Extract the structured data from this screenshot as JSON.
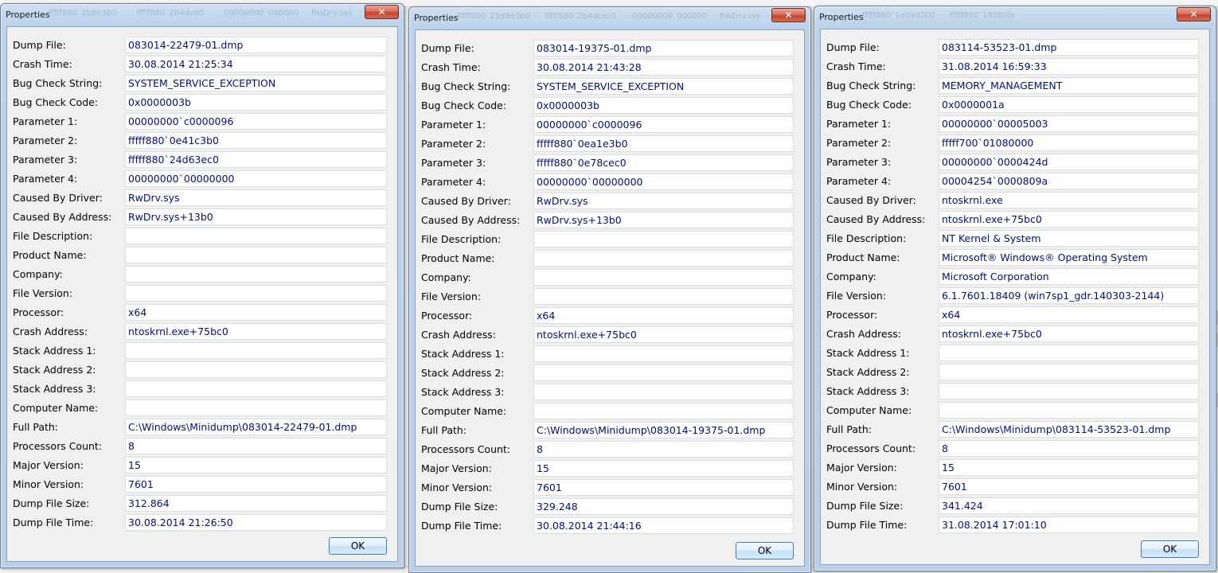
{
  "labels": [
    "Dump File:",
    "Crash Time:",
    "Bug Check String:",
    "Bug Check Code:",
    "Parameter 1:",
    "Parameter 2:",
    "Parameter 3:",
    "Parameter 4:",
    "Caused By Driver:",
    "Caused By Address:",
    "File Description:",
    "Product Name:",
    "Company:",
    "File Version:",
    "Processor:",
    "Crash Address:",
    "Stack Address 1:",
    "Stack Address 2:",
    "Stack Address 3:",
    "Computer Name:",
    "Full Path:",
    "Processors Count:",
    "Major Version:",
    "Minor Version:",
    "Dump File Size:",
    "Dump File Time:"
  ],
  "background": {
    "ghost_text": [
      [
        "fffff880`2b8e3b0",
        "fffff880`2b4dce0",
        "00000000`000000",
        "RwDrv.sys"
      ],
      [
        "fffff880`25d8e3b0",
        "fffff880`2b4dcec0",
        "00000000`000000",
        "RwDrv.sys"
      ],
      [
        "fffff880`1ebad3b0",
        "fffff880`1808fde"
      ]
    ]
  },
  "dialogs": [
    {
      "title": "Properties",
      "close_glyph": "✕",
      "ok_label": "OK",
      "values": [
        "083014-22479-01.dmp",
        "30.08.2014 21:25:34",
        "SYSTEM_SERVICE_EXCEPTION",
        "0x0000003b",
        "00000000`c0000096",
        "fffff880`0e41c3b0",
        "fffff880`24d63ec0",
        "00000000`00000000",
        "RwDrv.sys",
        "RwDrv.sys+13b0",
        "",
        "",
        "",
        "",
        "x64",
        "ntoskrnl.exe+75bc0",
        "",
        "",
        "",
        "",
        "C:\\Windows\\Minidump\\083014-22479-01.dmp",
        "8",
        "15",
        "7601",
        "312.864",
        "30.08.2014 21:26:50"
      ]
    },
    {
      "title": "Properties",
      "close_glyph": "✕",
      "ok_label": "OK",
      "values": [
        "083014-19375-01.dmp",
        "30.08.2014 21:43:28",
        "SYSTEM_SERVICE_EXCEPTION",
        "0x0000003b",
        "00000000`c0000096",
        "fffff880`0ea1e3b0",
        "fffff880`0e78cec0",
        "00000000`00000000",
        "RwDrv.sys",
        "RwDrv.sys+13b0",
        "",
        "",
        "",
        "",
        "x64",
        "ntoskrnl.exe+75bc0",
        "",
        "",
        "",
        "",
        "C:\\Windows\\Minidump\\083014-19375-01.dmp",
        "8",
        "15",
        "7601",
        "329.248",
        "30.08.2014 21:44:16"
      ]
    },
    {
      "title": "Properties",
      "close_glyph": "✕",
      "ok_label": "OK",
      "values": [
        "083114-53523-01.dmp",
        "31.08.2014 16:59:33",
        "MEMORY_MANAGEMENT",
        "0x0000001a",
        "00000000`00005003",
        "fffff700`01080000",
        "00000000`0000424d",
        "00004254`0000809a",
        "ntoskrnl.exe",
        "ntoskrnl.exe+75bc0",
        "NT Kernel & System",
        "Microsoft® Windows® Operating System",
        "Microsoft Corporation",
        "6.1.7601.18409 (win7sp1_gdr.140303-2144)",
        "x64",
        "ntoskrnl.exe+75bc0",
        "",
        "",
        "",
        "",
        "C:\\Windows\\Minidump\\083114-53523-01.dmp",
        "8",
        "15",
        "7601",
        "341.424",
        "31.08.2014 17:01:10"
      ]
    }
  ]
}
